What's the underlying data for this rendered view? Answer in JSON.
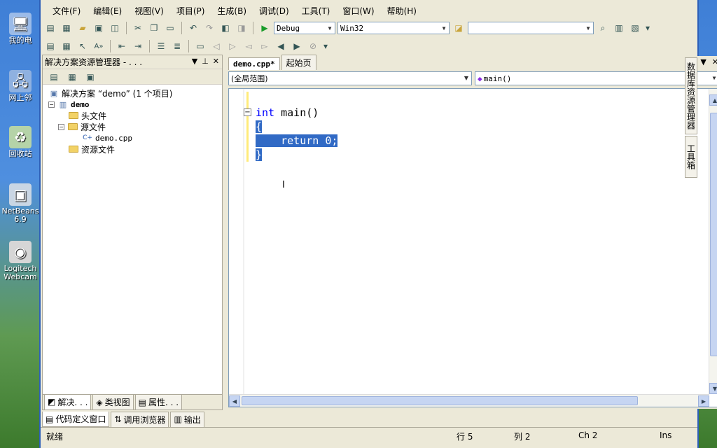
{
  "desktop": {
    "icons": [
      {
        "label": "我的电",
        "glyph": "🖥"
      },
      {
        "label": "网上邻",
        "glyph": "🖧"
      },
      {
        "label": "回收站",
        "glyph": "♻"
      },
      {
        "label": "NetBeans 6.9",
        "glyph": "▣"
      },
      {
        "label": "Logitech Webcam",
        "glyph": "◉"
      }
    ]
  },
  "menubar": {
    "items": [
      "文件(F)",
      "编辑(E)",
      "视图(V)",
      "项目(P)",
      "生成(B)",
      "调试(D)",
      "工具(T)",
      "窗口(W)",
      "帮助(H)"
    ]
  },
  "toolbar": {
    "config": "Debug",
    "platform": "Win32"
  },
  "solution_explorer": {
    "title": "解决方案资源管理器 - . . .",
    "tree": {
      "solution": "解决方案 “demo” (1 个项目)",
      "project": "demo",
      "header_folder": "头文件",
      "source_folder": "源文件",
      "source_file": "demo.cpp",
      "resource_folder": "资源文件"
    },
    "bottom_tabs": [
      "解决. . .",
      "类视图",
      "属性. . ."
    ]
  },
  "editor": {
    "tabs": [
      "demo.cpp*",
      "起始页"
    ],
    "scope": "(全局范围)",
    "member": "main()",
    "code": {
      "line1_kw": "int",
      "line1_rest": " main()",
      "line2": "{",
      "line3": "    return 0;",
      "line4": "}"
    }
  },
  "side_tabs": [
    "数据库资源管理器",
    "工具箱"
  ],
  "output_tabs": [
    "代码定义窗口",
    "调用浏览器",
    "输出"
  ],
  "statusbar": {
    "state": "就绪",
    "row": "行 5",
    "col": "列 2",
    "ch": "Ch 2",
    "mode": "Ins"
  }
}
